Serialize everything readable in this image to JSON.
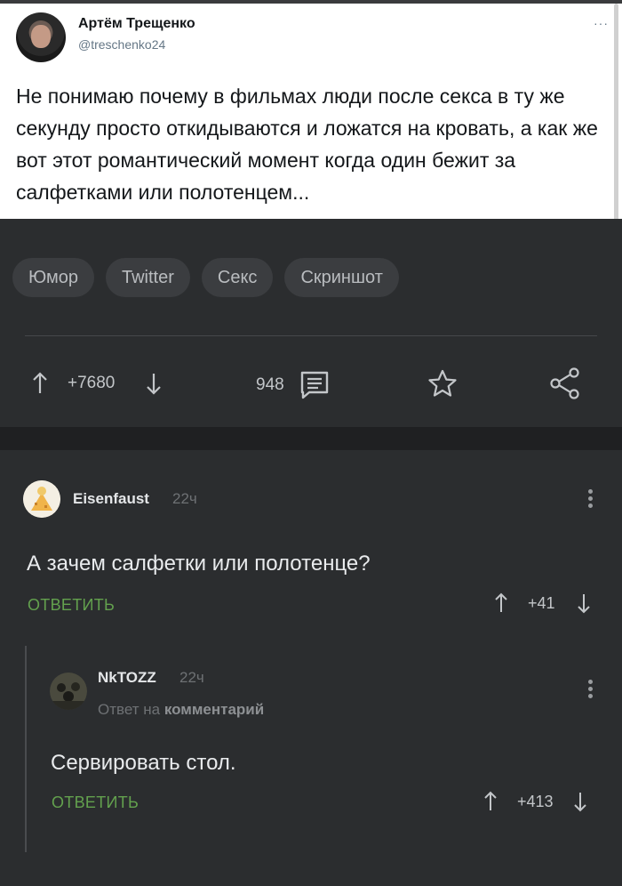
{
  "tweet": {
    "author_name": "Артём Трещенко",
    "author_handle": "@treschenko24",
    "more": "···",
    "text": "Не понимаю почему в фильмах люди после секса в ту же секунду просто откидываются и ложатся на кровать, а как же вот этот романтический момент когда один бежит за салфетками или полотенцем..."
  },
  "post": {
    "tags": [
      "Юмор",
      "Twitter",
      "Секс",
      "Скриншот"
    ],
    "rating": "+7680",
    "comments_count": "948",
    "icons": {
      "upvote": "arrow-up-icon",
      "downvote": "arrow-down-icon",
      "comments": "comments-icon",
      "save": "star-icon",
      "share": "share-icon"
    }
  },
  "comments": [
    {
      "author": "Eisenfaust",
      "time": "22ч",
      "text": "А зачем салфетки или полотенце?",
      "reply_label": "ОТВЕТИТЬ",
      "rating": "+41"
    },
    {
      "author": "NkTOZZ",
      "time": "22ч",
      "reply_to_prefix": "Ответ на",
      "reply_to_link": "комментарий",
      "text": "Сервировать стол.",
      "reply_label": "ОТВЕТИТЬ",
      "rating": "+413"
    }
  ],
  "colors": {
    "background": "#2b2d2f",
    "reply_green": "#63a14e",
    "tag_bg": "#3b3d40"
  }
}
